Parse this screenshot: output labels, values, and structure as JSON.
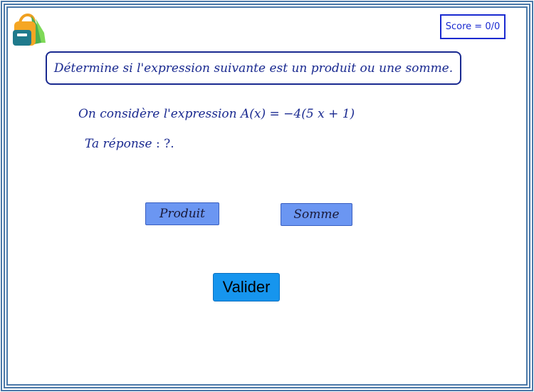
{
  "score": {
    "label": "Score = 0/0"
  },
  "instruction": {
    "text": "Détermine si l'expression suivante est un produit ou une somme."
  },
  "question": {
    "prefix": "On considère l'expression ",
    "expression": "A(x) = −4(5 x + 1)"
  },
  "answer": {
    "label": "Ta réponse",
    "value": " : ?."
  },
  "choices": {
    "produit": "Produit",
    "somme": "Somme"
  },
  "validate": {
    "label": "Valider"
  },
  "icons": {
    "logo": "backpack-icon"
  },
  "colors": {
    "frame": "#4a78a8",
    "text_blue": "#1a2a90",
    "score_blue": "#1a2ad0",
    "choice_bg": "#6b96f2",
    "validate_bg": "#1695ee"
  }
}
